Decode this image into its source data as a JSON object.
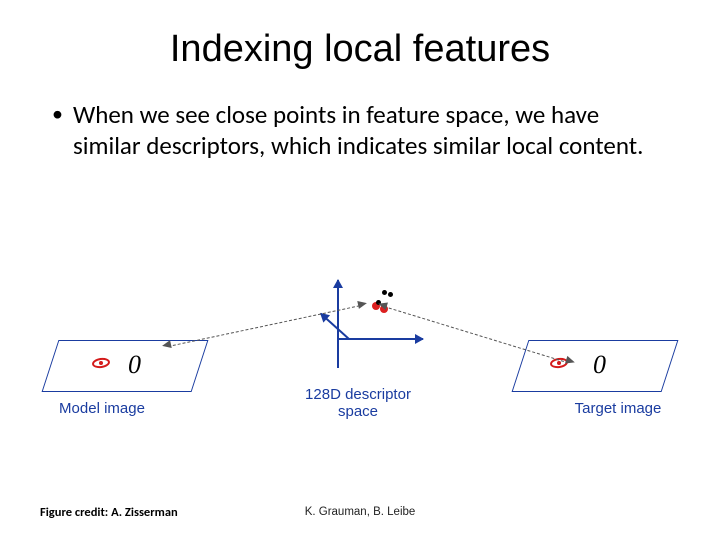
{
  "title": "Indexing local features",
  "bullet": "When we see close points in feature space, we have similar descriptors, which indicates similar local content.",
  "figure": {
    "model_label": "Model image",
    "descriptor_label": "128D descriptor space",
    "target_label": "Target image",
    "glyph_model": "0",
    "glyph_target": "0"
  },
  "credits": {
    "figure": "Figure credit: A. Zisserman",
    "authors": "K. Grauman, B. Leibe"
  }
}
